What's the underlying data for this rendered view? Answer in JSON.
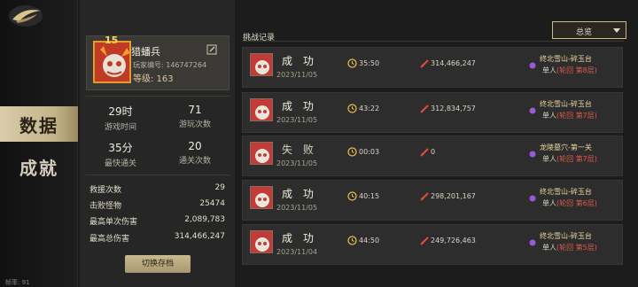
{
  "nav": {
    "items": [
      {
        "label": "数据",
        "active": true
      },
      {
        "label": "成就",
        "active": false
      }
    ],
    "fps": "帧率: 91"
  },
  "profile": {
    "name": "猎蟠兵",
    "id_text": "玩家编号: 146747264",
    "level_text": "等级: 163",
    "badge": "15"
  },
  "stats": [
    {
      "value": "29时",
      "label": "游戏时间"
    },
    {
      "value": "71",
      "label": "游玩次数"
    },
    {
      "value": "35分",
      "label": "最快通关"
    },
    {
      "value": "20",
      "label": "通关次数"
    }
  ],
  "details": [
    {
      "label": "救援次数",
      "value": "29"
    },
    {
      "label": "击败怪物",
      "value": "25474"
    },
    {
      "label": "最高单次伤害",
      "value": "2,089,783"
    },
    {
      "label": "最高总伤害",
      "value": "314,466,247"
    }
  ],
  "switch_button": "切换存档",
  "records": {
    "title": "挑战记录",
    "filter": "总览",
    "items": [
      {
        "result": "成 功",
        "fail": false,
        "date": "2023/11/05",
        "time": "35:50",
        "damage": "314,466,247",
        "stage": "终北雪山-碎玉台",
        "mode": "单人",
        "mode_detail": "(轮回 第8层)"
      },
      {
        "result": "成 功",
        "fail": false,
        "date": "2023/11/05",
        "time": "43:22",
        "damage": "312,834,757",
        "stage": "终北雪山-碎玉台",
        "mode": "单人",
        "mode_detail": "(轮回 第7层)"
      },
      {
        "result": "失 败",
        "fail": true,
        "date": "2023/11/05",
        "time": "00:03",
        "damage": "0",
        "stage": "龙陵墓穴-第一关",
        "mode": "单人",
        "mode_detail": "(轮回 第7层)"
      },
      {
        "result": "成 功",
        "fail": false,
        "date": "2023/11/05",
        "time": "40:15",
        "damage": "298,201,167",
        "stage": "终北雪山-碎玉台",
        "mode": "单人",
        "mode_detail": "(轮回 第6层)"
      },
      {
        "result": "成 功",
        "fail": false,
        "date": "2023/11/04",
        "time": "44:50",
        "damage": "249,726,463",
        "stage": "终北雪山-碎玉台",
        "mode": "单人",
        "mode_detail": "(轮回 第5层)"
      }
    ]
  },
  "colors": {
    "accent_gold": "#cdb98a",
    "fail_red": "#e05a4a",
    "purple_gem": "#9b59d6"
  }
}
